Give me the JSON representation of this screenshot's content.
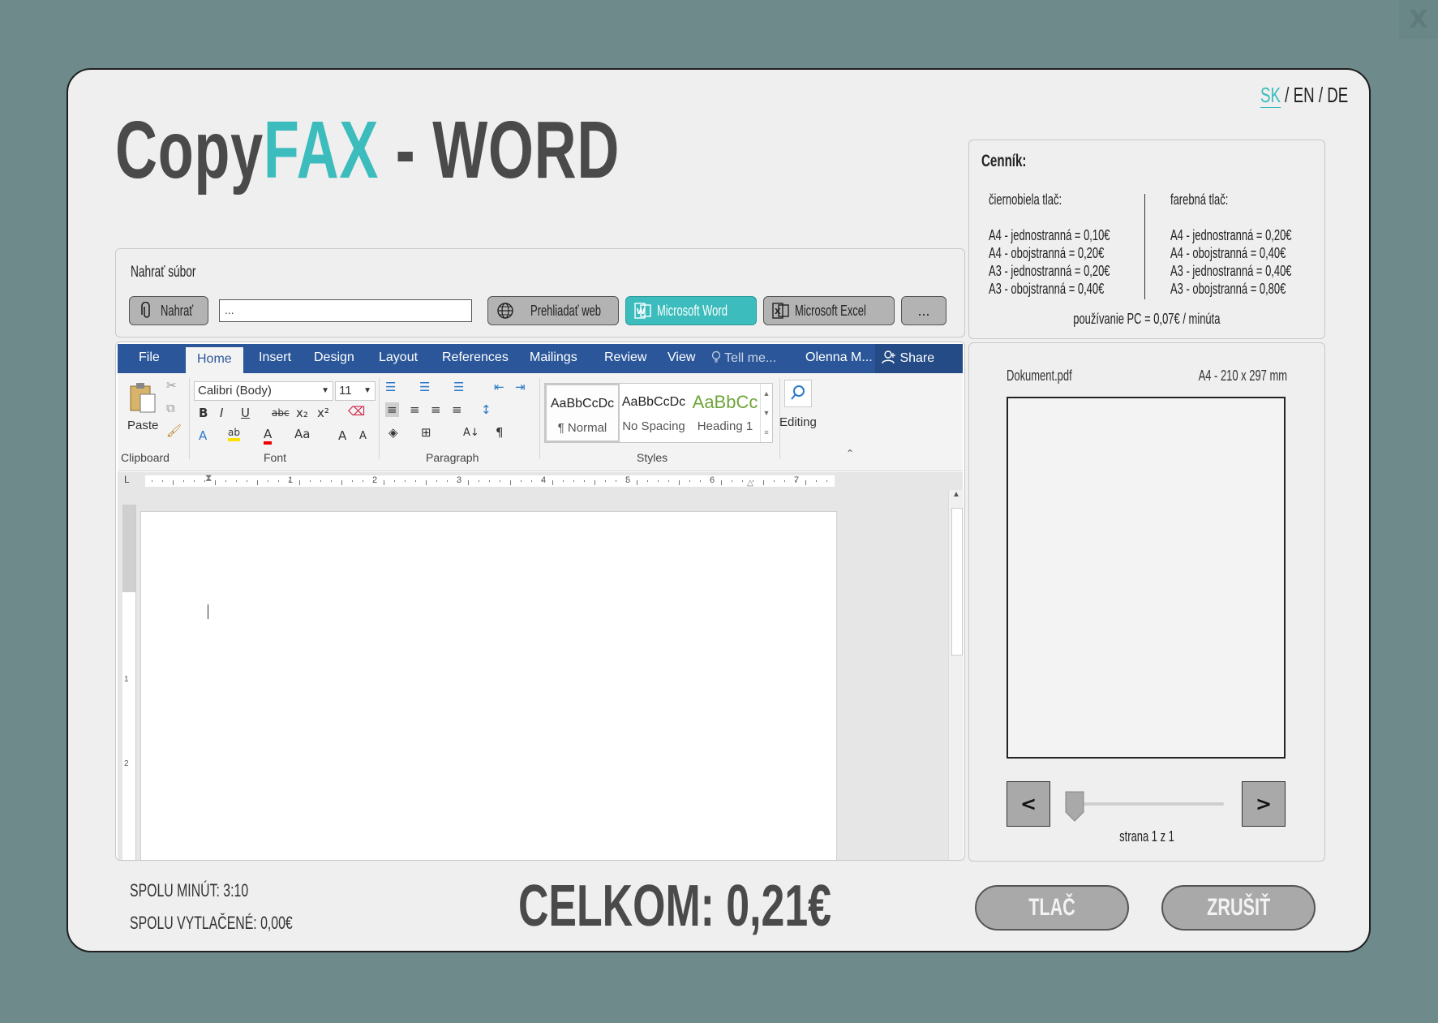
{
  "close_label": "X",
  "lang": {
    "sk": "SK",
    "en": "EN",
    "de": "DE",
    "sep": "/"
  },
  "title": {
    "part1": "Copy",
    "part2": "FAX",
    "part3": " - WORD"
  },
  "upload": {
    "label": "Nahrať súbor",
    "upload_btn": "Nahrať",
    "file_value": "...",
    "browse_btn": "Prehliadať web",
    "word_btn": "Microsoft Word",
    "excel_btn": "Microsoft Excel",
    "more_btn": "..."
  },
  "pricing": {
    "title": "Cenník:",
    "bw": {
      "header": "čiernobiela tlač:",
      "rows": [
        "A4 - jednostranná = 0,10€",
        "A4 - obojstranná = 0,20€",
        "A3 - jednostranná = 0,20€",
        "A3 - obojstranná = 0,40€"
      ]
    },
    "color": {
      "header": "farebná tlač:",
      "rows": [
        "A4 - jednostranná = 0,20€",
        "A4 - obojstranná = 0,40€",
        "A3 - jednostranná = 0,40€",
        "A3 - obojstranná = 0,80€"
      ]
    },
    "pc_note": "používanie PC = 0,07€ / minúta"
  },
  "word": {
    "tabs": [
      "File",
      "Home",
      "Insert",
      "Design",
      "Layout",
      "References",
      "Mailings",
      "Review",
      "View"
    ],
    "tell_me": "Tell me...",
    "user": "Olenna M...",
    "share": "Share",
    "paste": "Paste",
    "font_name": "Calibri (Body)",
    "font_size": "11",
    "groups": {
      "clipboard": "Clipboard",
      "font": "Font",
      "paragraph": "Paragraph",
      "styles": "Styles"
    },
    "styles": [
      {
        "preview": "AaBbCcDc",
        "name": "¶ Normal"
      },
      {
        "preview": "AaBbCcDc",
        "name": "No Spacing"
      },
      {
        "preview": "AaBbCc",
        "name": "Heading 1"
      }
    ],
    "editing": "Editing",
    "ruler_numbers": [
      "1",
      "2",
      "3",
      "4",
      "5",
      "6",
      "7"
    ],
    "vruler_numbers": [
      "1",
      "1",
      "2"
    ],
    "toolbar_glyphs": {
      "bold": "B",
      "italic": "I",
      "underline": "U",
      "strike": "abc",
      "sub": "x₂",
      "sup": "x²",
      "case": "Aa",
      "grow": "A",
      "shrink": "A",
      "pilcrow": "¶",
      "sort": "A↓",
      "highlight": "ab",
      "fontcolor": "A",
      "effects": "A"
    },
    "accent": "#2b579a"
  },
  "preview": {
    "filename": "Dokument.pdf",
    "size": "A4 - 210 x 297 mm",
    "prev": "<",
    "next": ">",
    "page_indicator": "strana 1 z 1",
    "slider_position": 0
  },
  "footer": {
    "minutes": "SPOLU MINÚT: 3:10",
    "printed": "SPOLU VYTLAČENÉ: 0,00€",
    "total": "CELKOM: 0,21€",
    "print": "TLAČ",
    "cancel": "ZRUŠIŤ"
  },
  "colors": {
    "background": "#6f8a8b",
    "accent": "#3cbcbc",
    "card": "#efefef",
    "button": "#a9a9a9"
  }
}
